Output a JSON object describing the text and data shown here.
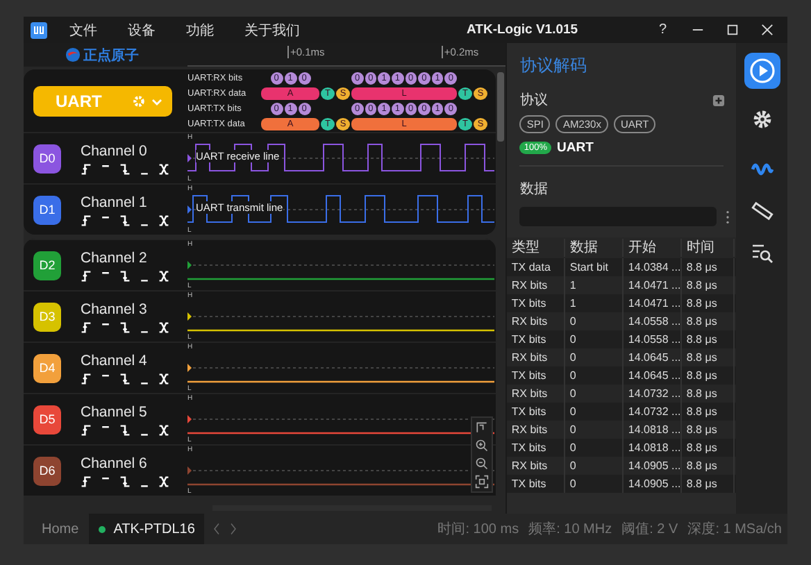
{
  "window": {
    "title": "ATK-Logic  V1.015",
    "help": "?"
  },
  "menu": [
    "文件",
    "设备",
    "功能",
    "关于我们"
  ],
  "brand": {
    "name": "正点原子"
  },
  "ruler": {
    "ticks": [
      "+0.1ms",
      "+0.2ms"
    ]
  },
  "decoder_group": {
    "decoder": {
      "label": "UART"
    },
    "annotations": [
      {
        "kind": "bits",
        "label": "UART:RX bits",
        "groups": [
          [
            "0",
            "1",
            "0"
          ],
          [
            "0",
            "0",
            "1",
            "1",
            "0",
            "0",
            "1",
            "0"
          ]
        ]
      },
      {
        "kind": "data",
        "label": "UART:RX data",
        "color": "#e8336e",
        "segments": [
          {
            "kind": "bar",
            "text": "A"
          },
          {
            "kind": "stop",
            "text": "T"
          },
          {
            "kind": "start",
            "text": "S"
          },
          {
            "kind": "bar",
            "text": "L"
          },
          {
            "kind": "stop",
            "text": "T"
          },
          {
            "kind": "start",
            "text": "S"
          }
        ]
      },
      {
        "kind": "bits",
        "label": "UART:TX bits",
        "groups": [
          [
            "0",
            "1",
            "0"
          ],
          [
            "0",
            "0",
            "1",
            "1",
            "0",
            "0",
            "1",
            "0"
          ]
        ]
      },
      {
        "kind": "data",
        "label": "UART:TX data",
        "color": "#f0703c",
        "segments": [
          {
            "kind": "bar",
            "text": "A"
          },
          {
            "kind": "stop",
            "text": "T"
          },
          {
            "kind": "start",
            "text": "S"
          },
          {
            "kind": "bar",
            "text": "L"
          },
          {
            "kind": "stop",
            "text": "T"
          },
          {
            "kind": "start",
            "text": "S"
          }
        ]
      }
    ],
    "channels": [
      {
        "badge": "D0",
        "name": "Channel 0",
        "color": "#8b55e0",
        "kind": "pulses",
        "signal": "UART receive line",
        "high_mark": "H",
        "low_mark": "L"
      },
      {
        "badge": "D1",
        "name": "Channel 1",
        "color": "#3a6ee8",
        "kind": "pulses",
        "signal": "UART transmit line",
        "high_mark": "H",
        "low_mark": "L"
      }
    ]
  },
  "channel_group": {
    "channels": [
      {
        "badge": "D2",
        "name": "Channel 2",
        "color": "#21a038",
        "kind": "flat",
        "high_mark": "H",
        "low_mark": "L"
      },
      {
        "badge": "D3",
        "name": "Channel 3",
        "color": "#d6c200",
        "kind": "flat",
        "high_mark": "H",
        "low_mark": "L"
      },
      {
        "badge": "D4",
        "name": "Channel 4",
        "color": "#f2a03c",
        "kind": "flat",
        "high_mark": "H",
        "low_mark": "L"
      },
      {
        "badge": "D5",
        "name": "Channel 5",
        "color": "#e8483a",
        "kind": "flat",
        "high_mark": "H",
        "low_mark": "L"
      },
      {
        "badge": "D6",
        "name": "Channel 6",
        "color": "#8e4430",
        "kind": "flat",
        "high_mark": "H",
        "low_mark": "L"
      }
    ]
  },
  "right_panel": {
    "title": "协议解码",
    "protocol_label": "协议",
    "protocols": [
      "SPI",
      "AM230x",
      "UART"
    ],
    "active_decoder": {
      "progress": "100%",
      "name": "UART"
    },
    "data_label": "数据",
    "table": {
      "columns": [
        "类型",
        "数据",
        "开始",
        "时间"
      ],
      "rows": [
        [
          "TX data",
          "Start bit",
          "14.0384 ...",
          "8.8 μs"
        ],
        [
          "RX bits",
          "1",
          "14.0471 ...",
          "8.8 μs"
        ],
        [
          "TX bits",
          "1",
          "14.0471 ...",
          "8.8 μs"
        ],
        [
          "RX bits",
          "0",
          "14.0558 ...",
          "8.8 μs"
        ],
        [
          "TX bits",
          "0",
          "14.0558 ...",
          "8.8 μs"
        ],
        [
          "RX bits",
          "0",
          "14.0645 ...",
          "8.8 μs"
        ],
        [
          "TX bits",
          "0",
          "14.0645 ...",
          "8.8 μs"
        ],
        [
          "RX bits",
          "0",
          "14.0732 ...",
          "8.8 μs"
        ],
        [
          "TX bits",
          "0",
          "14.0732 ...",
          "8.8 μs"
        ],
        [
          "RX bits",
          "0",
          "14.0818 ...",
          "8.8 μs"
        ],
        [
          "TX bits",
          "0",
          "14.0818 ...",
          "8.8 μs"
        ],
        [
          "RX bits",
          "0",
          "14.0905 ...",
          "8.8 μs"
        ],
        [
          "TX bits",
          "0",
          "14.0905 ...",
          "8.8 μs"
        ]
      ]
    }
  },
  "tools": [
    {
      "kind": "play",
      "selected": false
    },
    {
      "kind": "settings",
      "selected": false
    },
    {
      "kind": "waveform",
      "selected": true
    },
    {
      "kind": "ruler",
      "selected": false
    },
    {
      "kind": "search",
      "selected": false
    }
  ],
  "tabs": [
    {
      "label": "Home",
      "selected": false,
      "connected": false
    },
    {
      "label": "ATK-PTDL16",
      "selected": true,
      "connected": true
    }
  ],
  "status": [
    "时间: 100 ms",
    "频率: 10 MHz",
    "阈值: 2 V",
    "深度: 1 MSa/ch"
  ]
}
